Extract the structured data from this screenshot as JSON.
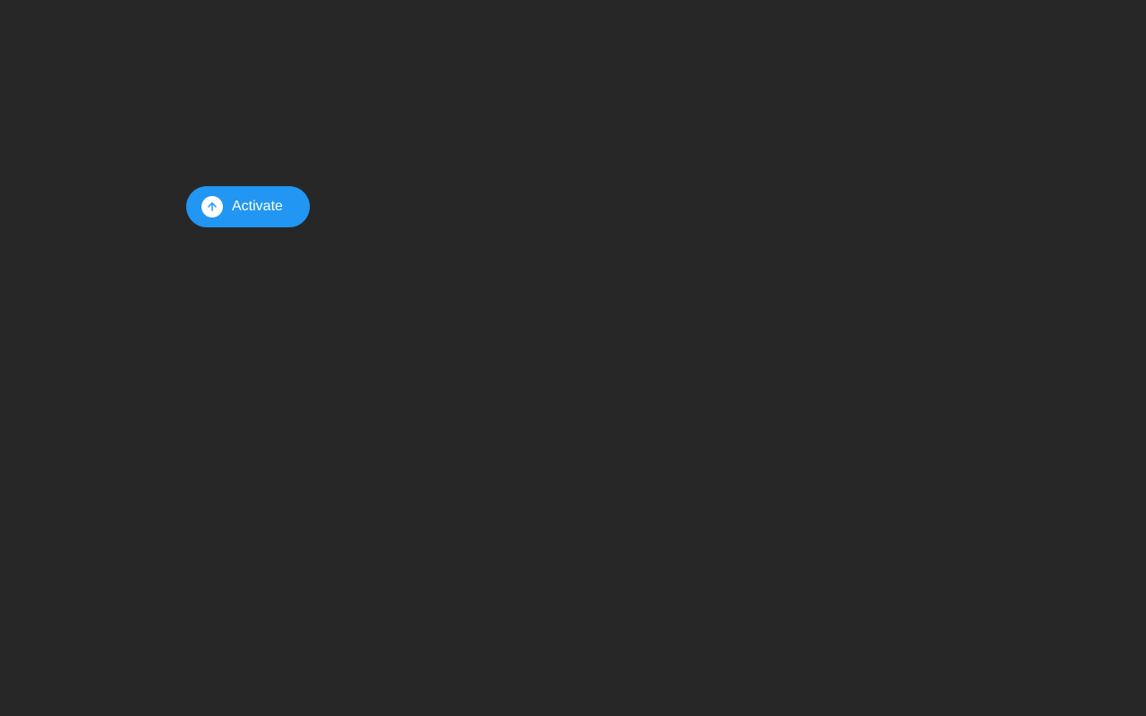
{
  "button": {
    "label": "Activate",
    "accent_color": "#2196f3",
    "icon_color": "#2196f3"
  }
}
